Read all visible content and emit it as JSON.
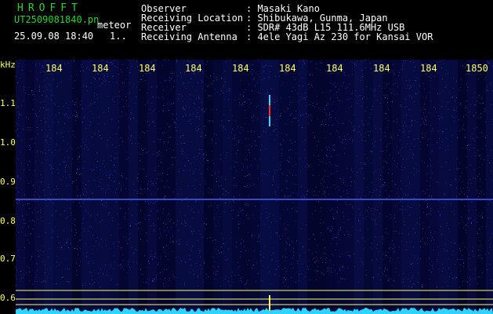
{
  "header": {
    "title": "HROFFT",
    "file_name": "UT2509081840.pn",
    "tag": "meteor",
    "date_time": "25.09.08 18:40",
    "index": "1..",
    "info_labels": [
      "Observer",
      "Receiving Location",
      "Receiver",
      "Receiving Antenna"
    ],
    "info_values": [
      ": Masaki Kano",
      ": Shibukawa, Gunma, Japan",
      ": SDR# 43dB L15 111.6MHz USB",
      ": 4ele Yagi Az 230 for Kansai VOR"
    ]
  },
  "axis": {
    "unit": "kHz",
    "y_ticks": [
      "1.1",
      "1.0",
      "0.9",
      "0.8",
      "0.7",
      "0.6"
    ],
    "x_ticks": [
      "184",
      "184",
      "184",
      "184",
      "184",
      "184",
      "184",
      "184",
      "184",
      "1850"
    ]
  },
  "colors": {
    "background": "#00001e",
    "noise": "#1a2aa0",
    "grid_line": "#ffff66",
    "meteor_echo": "#ff2b2b",
    "meteor_echo_edge": "#37d6ff",
    "spectrum_trace": "#2fd3ff"
  }
}
